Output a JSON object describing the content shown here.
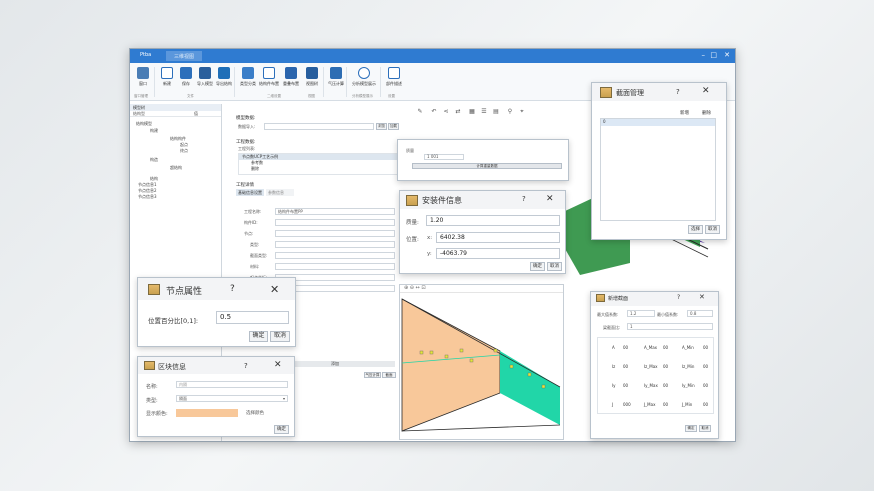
{
  "app": {
    "title": "Ptba",
    "tab2": "三维视图"
  },
  "ribbon": {
    "buttons": [
      "窗口",
      "新建",
      "保存",
      "导入模型",
      "导出结构",
      "类型分类",
      "结构件布置",
      "重叠布置",
      "视图树",
      "气压计算",
      "分析模型展示",
      "部件描述"
    ],
    "groups": [
      "窗口管理",
      "文件",
      "二维设置",
      "视图",
      "分析模型展示",
      "设置"
    ]
  },
  "leftpanel": {
    "header": "模型树",
    "col1": "结构型",
    "col2": "值",
    "tree": [
      "结构模型",
      "构建",
      "结构构件",
      "起点",
      "终点",
      "构造",
      "超结构",
      "结构",
      "节点信息1",
      "节点信息2",
      "节点信息3"
    ]
  },
  "midpanel": {
    "sec1": "模型数据:",
    "model_label": "数据导入:",
    "browse": "浏览",
    "ok": "加载",
    "sec2": "工程数据:",
    "list_label": "工程列表:",
    "list_item1": "节点数UCP工艺示例",
    "list_item2": "参考数",
    "list_item3": "删除",
    "sec3": "工程详情",
    "tab_a": "基础信息设置",
    "tab_b": "参数信息",
    "rows": [
      "工程名称:",
      "构件ID:",
      "节点:",
      "类型:",
      "截面类型:",
      "材料:",
      "起点坐标:",
      "终点坐标:"
    ],
    "name_val": "结构件布置PP",
    "footer_btn": "添加",
    "footer2": "气压计算",
    "footer3": "截面"
  },
  "attr_dialog": {
    "label": "质量",
    "value": "1 001",
    "btn": "计算重量数据"
  },
  "install_dialog": {
    "title": "安装件信息",
    "help": "?",
    "close": "✕",
    "mass_label": "质量:",
    "mass_value": "1.20",
    "pos_label": "位置:",
    "x_label": "x:",
    "x_value": "6402.38",
    "y_label": "y:",
    "y_value": "-4063.79",
    "ok": "确定",
    "cancel": "取消"
  },
  "section_mgr": {
    "title": "截面管理",
    "help": "?",
    "close": "✕",
    "add": "新增",
    "del": "删除",
    "item": "0",
    "ok": "选择",
    "cancel": "取消"
  },
  "node_dialog": {
    "title": "节点属性",
    "help": "?",
    "close": "✕",
    "label": "位置百分比[0,1]:",
    "value": "0.5",
    "ok": "确定",
    "cancel": "取消"
  },
  "block_dialog": {
    "title": "区块信息",
    "help": "?",
    "close": "✕",
    "name_label": "名称:",
    "name_placeholder": "内隔",
    "type_label": "类型:",
    "type_value": "隔面",
    "color_label": "显示颜色:",
    "color_btn": "选择颜色",
    "ok": "确定",
    "color": "#f8c89a"
  },
  "newsection": {
    "title": "新增截面",
    "help": "?",
    "close": "✕",
    "max_label": "最大值系数:",
    "max_value": "1.2",
    "min_label": "最小值系数:",
    "min_value": "0.8",
    "ratio_label": "梁截面比:",
    "ratio_value": "1",
    "rows": [
      {
        "a": "A",
        "b": "00",
        "c": "A_Max",
        "d": "00",
        "e": "A_Min",
        "f": "00"
      },
      {
        "a": "Iz",
        "b": "00",
        "c": "Iz_Max",
        "d": "00",
        "e": "Iz_Min",
        "f": "00"
      },
      {
        "a": "Iy",
        "b": "00",
        "c": "Iy_Max",
        "d": "00",
        "e": "Iy_Min",
        "f": "00"
      },
      {
        "a": "J",
        "b": "000",
        "c": "J_Max",
        "d": "00",
        "e": "J_Min",
        "f": "00"
      }
    ],
    "ok": "确定",
    "cancel": "取消"
  },
  "colors": {
    "accent": "#2f7bd1",
    "green": "#3f9a52",
    "teal": "#21d6a8",
    "peach": "#f8c89a",
    "purple": "#5b3aa8"
  }
}
